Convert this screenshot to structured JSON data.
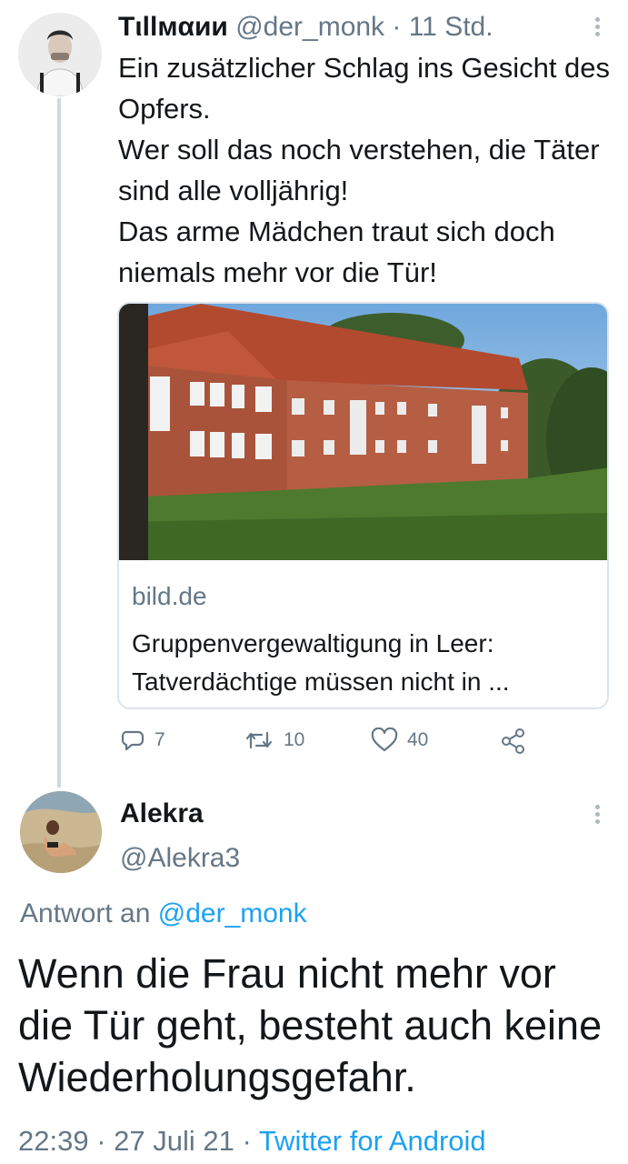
{
  "tweet1": {
    "author_name": "Tιllмαии",
    "author_handle": "@der_monk",
    "time": " · 11 Std.",
    "text": "Ein zusätzlicher Schlag ins Gesicht des Opfers.\nWer soll das noch verstehen, die Täter sind alle volljährig!\nDas arme Mädchen traut sich doch niemals mehr vor die Tür!",
    "card": {
      "domain": "bild.de",
      "title": "Gruppenvergewaltigung in Leer: Tatverdächtige müssen nicht in ..."
    },
    "actions": {
      "replies": "7",
      "retweets": "10",
      "likes": "40"
    }
  },
  "tweet2": {
    "author_name": "Alekra",
    "author_handle": "@Alekra3",
    "reply_prefix": "Antwort an ",
    "reply_mention": "@der_monk",
    "text": "Wenn die Frau nicht mehr vor die Tür geht, besteht auch keine Wiederholungsgefahr.",
    "timestamp": "22:39 · 27 Juli 21 · ",
    "source": "Twitter for Android"
  },
  "icons": {
    "reply": "reply-icon",
    "retweet": "retweet-icon",
    "like": "heart-icon",
    "share": "share-icon",
    "more": "more-vertical-icon"
  },
  "colors": {
    "text": "#14171a",
    "secondary": "#657786",
    "link": "#1da1f2",
    "border": "#dde4ea",
    "thread_line": "#cfd9de"
  }
}
